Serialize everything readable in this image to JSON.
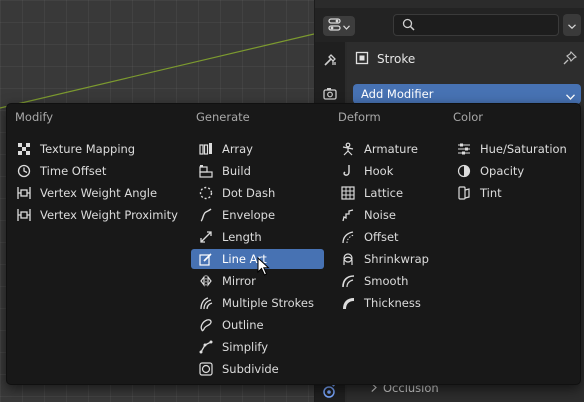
{
  "properties": {
    "search_placeholder": "",
    "object_name": "Stroke",
    "add_modifier_label": "Add Modifier",
    "occlusion_label": "Occlusion"
  },
  "menu": {
    "columns": [
      {
        "header": "Modify",
        "items": [
          {
            "label": "Texture Mapping",
            "icon": "texture-mapping-icon"
          },
          {
            "label": "Time Offset",
            "icon": "time-offset-icon"
          },
          {
            "label": "Vertex Weight Angle",
            "icon": "vertex-weight-icon"
          },
          {
            "label": "Vertex Weight Proximity",
            "icon": "vertex-weight-icon"
          }
        ]
      },
      {
        "header": "Generate",
        "items": [
          {
            "label": "Array",
            "icon": "array-icon"
          },
          {
            "label": "Build",
            "icon": "build-icon"
          },
          {
            "label": "Dot Dash",
            "icon": "dot-dash-icon"
          },
          {
            "label": "Envelope",
            "icon": "envelope-icon"
          },
          {
            "label": "Length",
            "icon": "length-icon"
          },
          {
            "label": "Line Art",
            "icon": "line-art-icon",
            "active": true
          },
          {
            "label": "Mirror",
            "icon": "mirror-icon"
          },
          {
            "label": "Multiple Strokes",
            "icon": "multiple-strokes-icon"
          },
          {
            "label": "Outline",
            "icon": "outline-icon"
          },
          {
            "label": "Simplify",
            "icon": "simplify-icon"
          },
          {
            "label": "Subdivide",
            "icon": "subdivide-icon"
          }
        ]
      },
      {
        "header": "Deform",
        "items": [
          {
            "label": "Armature",
            "icon": "armature-icon"
          },
          {
            "label": "Hook",
            "icon": "hook-icon"
          },
          {
            "label": "Lattice",
            "icon": "lattice-icon"
          },
          {
            "label": "Noise",
            "icon": "noise-icon"
          },
          {
            "label": "Offset",
            "icon": "offset-icon"
          },
          {
            "label": "Shrinkwrap",
            "icon": "shrinkwrap-icon"
          },
          {
            "label": "Smooth",
            "icon": "smooth-icon"
          },
          {
            "label": "Thickness",
            "icon": "thickness-icon"
          }
        ]
      },
      {
        "header": "Color",
        "items": [
          {
            "label": "Hue/Saturation",
            "icon": "hue-saturation-icon"
          },
          {
            "label": "Opacity",
            "icon": "opacity-icon"
          },
          {
            "label": "Tint",
            "icon": "tint-icon"
          }
        ]
      }
    ]
  },
  "colors": {
    "accent": "#4772b3",
    "menu_bg": "#181818",
    "axis_line": "#7c9a2f"
  }
}
